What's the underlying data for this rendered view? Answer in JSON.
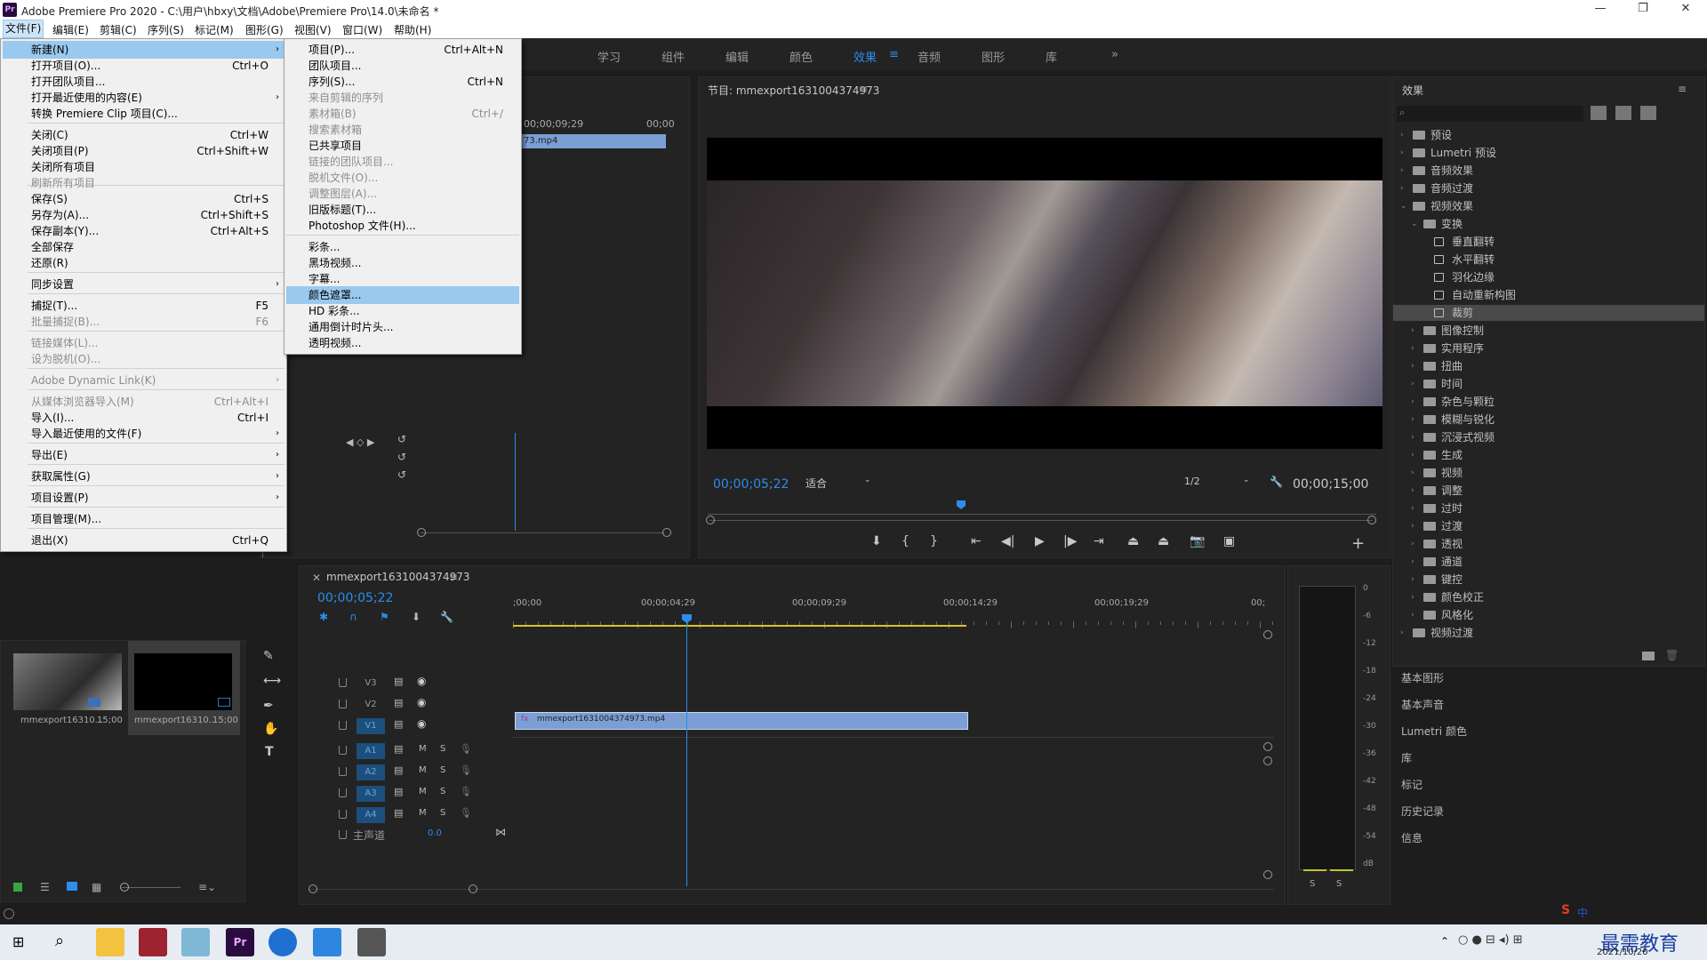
{
  "window": {
    "title": "Adobe Premiere Pro 2020 - C:\\用户\\hbxy\\文档\\Adobe\\Premiere Pro\\14.0\\未命名 *",
    "app_icon": "Pr"
  },
  "menubar": [
    "文件(F)",
    "编辑(E)",
    "剪辑(C)",
    "序列(S)",
    "标记(M)",
    "图形(G)",
    "视图(V)",
    "窗口(W)",
    "帮助(H)"
  ],
  "workspaces": [
    "学习",
    "组件",
    "编辑",
    "颜色",
    "效果",
    "音频",
    "图形",
    "库"
  ],
  "file_menu": [
    {
      "label": "新建(N)",
      "shortcut": "",
      "submenu": true,
      "highlight": true
    },
    {
      "label": "打开项目(O)...",
      "shortcut": "Ctrl+O"
    },
    {
      "label": "打开团队项目..."
    },
    {
      "label": "打开最近使用的内容(E)",
      "submenu": true
    },
    {
      "label": "转换 Premiere Clip 项目(C)..."
    },
    {
      "label": "关闭(C)",
      "shortcut": "Ctrl+W"
    },
    {
      "label": "关闭项目(P)",
      "shortcut": "Ctrl+Shift+W"
    },
    {
      "label": "关闭所有项目"
    },
    {
      "label": "刷新所有项目",
      "disabled": true
    },
    {
      "label": "保存(S)",
      "shortcut": "Ctrl+S"
    },
    {
      "label": "另存为(A)...",
      "shortcut": "Ctrl+Shift+S"
    },
    {
      "label": "保存副本(Y)...",
      "shortcut": "Ctrl+Alt+S"
    },
    {
      "label": "全部保存"
    },
    {
      "label": "还原(R)"
    },
    {
      "label": "同步设置",
      "submenu": true
    },
    {
      "label": "捕捉(T)...",
      "shortcut": "F5"
    },
    {
      "label": "批量捕捉(B)...",
      "shortcut": "F6",
      "disabled": true
    },
    {
      "label": "链接媒体(L)...",
      "disabled": true
    },
    {
      "label": "设为脱机(O)...",
      "disabled": true
    },
    {
      "label": "Adobe Dynamic Link(K)",
      "submenu": true,
      "disabled": true
    },
    {
      "label": "从媒体浏览器导入(M)",
      "shortcut": "Ctrl+Alt+I",
      "disabled": true
    },
    {
      "label": "导入(I)...",
      "shortcut": "Ctrl+I"
    },
    {
      "label": "导入最近使用的文件(F)",
      "submenu": true
    },
    {
      "label": "导出(E)",
      "submenu": true
    },
    {
      "label": "获取属性(G)",
      "submenu": true
    },
    {
      "label": "项目设置(P)",
      "submenu": true
    },
    {
      "label": "项目管理(M)..."
    },
    {
      "label": "退出(X)",
      "shortcut": "Ctrl+Q"
    }
  ],
  "new_submenu": [
    {
      "label": "项目(P)...",
      "shortcut": "Ctrl+Alt+N"
    },
    {
      "label": "团队项目..."
    },
    {
      "label": "序列(S)...",
      "shortcut": "Ctrl+N"
    },
    {
      "label": "来自剪辑的序列",
      "disabled": true
    },
    {
      "label": "素材箱(B)",
      "shortcut": "Ctrl+/",
      "disabled": true
    },
    {
      "label": "搜索素材箱",
      "disabled": true
    },
    {
      "label": "已共享项目"
    },
    {
      "label": "链接的团队项目...",
      "disabled": true
    },
    {
      "label": "脱机文件(O)...",
      "disabled": true
    },
    {
      "label": "调整图层(A)...",
      "disabled": true
    },
    {
      "label": "旧版标题(T)..."
    },
    {
      "label": "Photoshop 文件(H)..."
    },
    {
      "label": "彩条..."
    },
    {
      "label": "黑场视频..."
    },
    {
      "label": "字幕..."
    },
    {
      "label": "颜色遮罩...",
      "highlight": true
    },
    {
      "label": "HD 彩条..."
    },
    {
      "label": "通用倒计时片头..."
    },
    {
      "label": "透明视频..."
    }
  ],
  "source_panel": {
    "time_a": "00;00;09;29",
    "time_b": "00;00",
    "clip_label": "73.mp4"
  },
  "program_monitor": {
    "title": "节目: mmexport1631004374973",
    "timecode": "00;00;05;22",
    "fit": "适合",
    "resolution": "1/2",
    "duration": "00;00;15;00"
  },
  "effects_panel": {
    "title": "效果",
    "tree": [
      {
        "label": "预设",
        "level": 0,
        "kind": "folder"
      },
      {
        "label": "Lumetri 预设",
        "level": 0,
        "kind": "folder"
      },
      {
        "label": "音频效果",
        "level": 0,
        "kind": "folder"
      },
      {
        "label": "音频过渡",
        "level": 0,
        "kind": "folder"
      },
      {
        "label": "视频效果",
        "level": 0,
        "kind": "folder",
        "open": true
      },
      {
        "label": "变换",
        "level": 1,
        "kind": "folder",
        "open": true
      },
      {
        "label": "垂直翻转",
        "level": 2,
        "kind": "fx"
      },
      {
        "label": "水平翻转",
        "level": 2,
        "kind": "fx"
      },
      {
        "label": "羽化边缘",
        "level": 2,
        "kind": "fx"
      },
      {
        "label": "自动重新构图",
        "level": 2,
        "kind": "fx"
      },
      {
        "label": "裁剪",
        "level": 2,
        "kind": "fx",
        "selected": true
      },
      {
        "label": "图像控制",
        "level": 1,
        "kind": "folder"
      },
      {
        "label": "实用程序",
        "level": 1,
        "kind": "folder"
      },
      {
        "label": "扭曲",
        "level": 1,
        "kind": "folder"
      },
      {
        "label": "时间",
        "level": 1,
        "kind": "folder"
      },
      {
        "label": "杂色与颗粒",
        "level": 1,
        "kind": "folder"
      },
      {
        "label": "模糊与锐化",
        "level": 1,
        "kind": "folder"
      },
      {
        "label": "沉浸式视频",
        "level": 1,
        "kind": "folder"
      },
      {
        "label": "生成",
        "level": 1,
        "kind": "folder"
      },
      {
        "label": "视频",
        "level": 1,
        "kind": "folder"
      },
      {
        "label": "调整",
        "level": 1,
        "kind": "folder"
      },
      {
        "label": "过时",
        "level": 1,
        "kind": "folder"
      },
      {
        "label": "过渡",
        "level": 1,
        "kind": "folder"
      },
      {
        "label": "透视",
        "level": 1,
        "kind": "folder"
      },
      {
        "label": "通道",
        "level": 1,
        "kind": "folder"
      },
      {
        "label": "键控",
        "level": 1,
        "kind": "folder"
      },
      {
        "label": "颜色校正",
        "level": 1,
        "kind": "folder"
      },
      {
        "label": "风格化",
        "level": 1,
        "kind": "folder"
      },
      {
        "label": "视频过渡",
        "level": 0,
        "kind": "folder"
      }
    ]
  },
  "right_sections": [
    "基本图形",
    "基本声音",
    "Lumetri 颜色",
    "库",
    "标记",
    "历史记录",
    "信息"
  ],
  "project_panel": {
    "items": [
      {
        "name": "mmexport16310...",
        "duration": "15;00"
      },
      {
        "name": "mmexport16310...",
        "duration": "15;00"
      }
    ]
  },
  "timeline": {
    "tab": "mmexport1631004374973",
    "timecode": "00;00;05;22",
    "ruler": [
      ";00;00",
      "00;00;04;29",
      "00;00;09;29",
      "00;00;14;29",
      "00;00;19;29",
      "00;"
    ],
    "video_tracks": [
      "V3",
      "V2",
      "V1"
    ],
    "audio_tracks": [
      "A1",
      "A2",
      "A3",
      "A4"
    ],
    "master_label": "主声道",
    "master_value": "0.0",
    "clip_name": "mmexport1631004374973.mp4",
    "clip_fx": "fx"
  },
  "meter_scale": [
    "0",
    "-6",
    "-12",
    "-18",
    "-24",
    "-30",
    "-36",
    "-42",
    "-48",
    "-54",
    "dB"
  ],
  "meter_solo": [
    "S",
    "S"
  ],
  "taskbar": {
    "date": "2021/10/20",
    "watermark": "最需教育",
    "ime": "中"
  },
  "colors": {
    "accent": "#2d8ceb",
    "menu_highlight": "#99c9ef",
    "clip": "#7b9fd4",
    "playhead": "#2d8ceb"
  }
}
